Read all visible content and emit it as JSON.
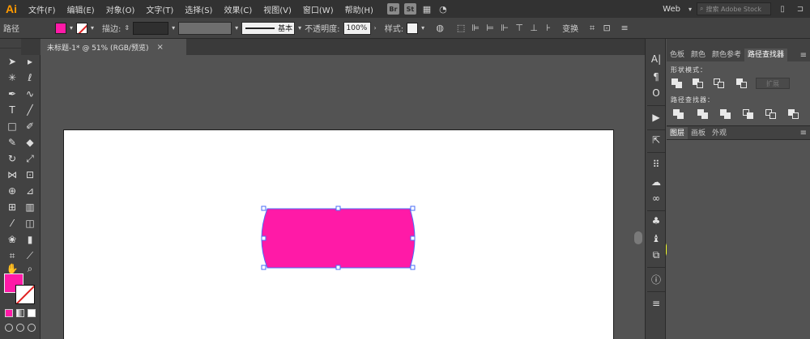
{
  "app": {
    "logo": "Ai",
    "menus": [
      "文件(F)",
      "编辑(E)",
      "对象(O)",
      "文字(T)",
      "选择(S)",
      "效果(C)",
      "视图(V)",
      "窗口(W)",
      "帮助(H)"
    ],
    "badges": [
      "Br",
      "St"
    ],
    "workspace": "Web",
    "search_placeholder": "搜索 Adobe Stock"
  },
  "control_bar": {
    "selection_label": "路径",
    "fill_color": "#ff1aa7",
    "stroke_label": "描边:",
    "stroke_style_label": "基本",
    "opacity_label": "不透明度:",
    "opacity_value": "100%",
    "style_label": "样式:",
    "transform_label": "变换"
  },
  "document": {
    "tab_title": "未标题-1* @ 51% (RGB/预览)",
    "close_glyph": "×"
  },
  "toolbar": {
    "fill_color": "#ff1aa7",
    "icons": [
      "selection-tool-icon",
      "direct-selection-tool-icon",
      "magic-wand-tool-icon",
      "lasso-tool-icon",
      "pen-tool-icon",
      "curvature-tool-icon",
      "type-tool-icon",
      "line-segment-tool-icon",
      "rectangle-tool-icon",
      "paintbrush-tool-icon",
      "shaper-tool-icon",
      "eraser-tool-icon",
      "rotate-tool-icon",
      "scale-tool-icon",
      "width-tool-icon",
      "free-transform-tool-icon",
      "shape-builder-tool-icon",
      "perspective-grid-tool-icon",
      "mesh-tool-icon",
      "gradient-tool-icon",
      "eyedropper-tool-icon",
      "blend-tool-icon",
      "symbol-sprayer-tool-icon",
      "column-graph-tool-icon",
      "artboard-tool-icon",
      "slice-tool-icon",
      "hand-tool-icon",
      "zoom-tool-icon"
    ]
  },
  "canvas": {
    "shape_fill": "#ff1aa7",
    "selection_color": "#4a6cf7",
    "annotation_arrow_color": "#f5ff2a"
  },
  "panel": {
    "tabs": [
      "色板",
      "颜色",
      "颜色参考",
      "路径查找器"
    ],
    "shape_modes_label": "形状模式：",
    "expand_label": "扩展",
    "pathfinders_label": "路径查找器：",
    "layers_tabs": [
      "图层",
      "画板",
      "外观"
    ]
  }
}
